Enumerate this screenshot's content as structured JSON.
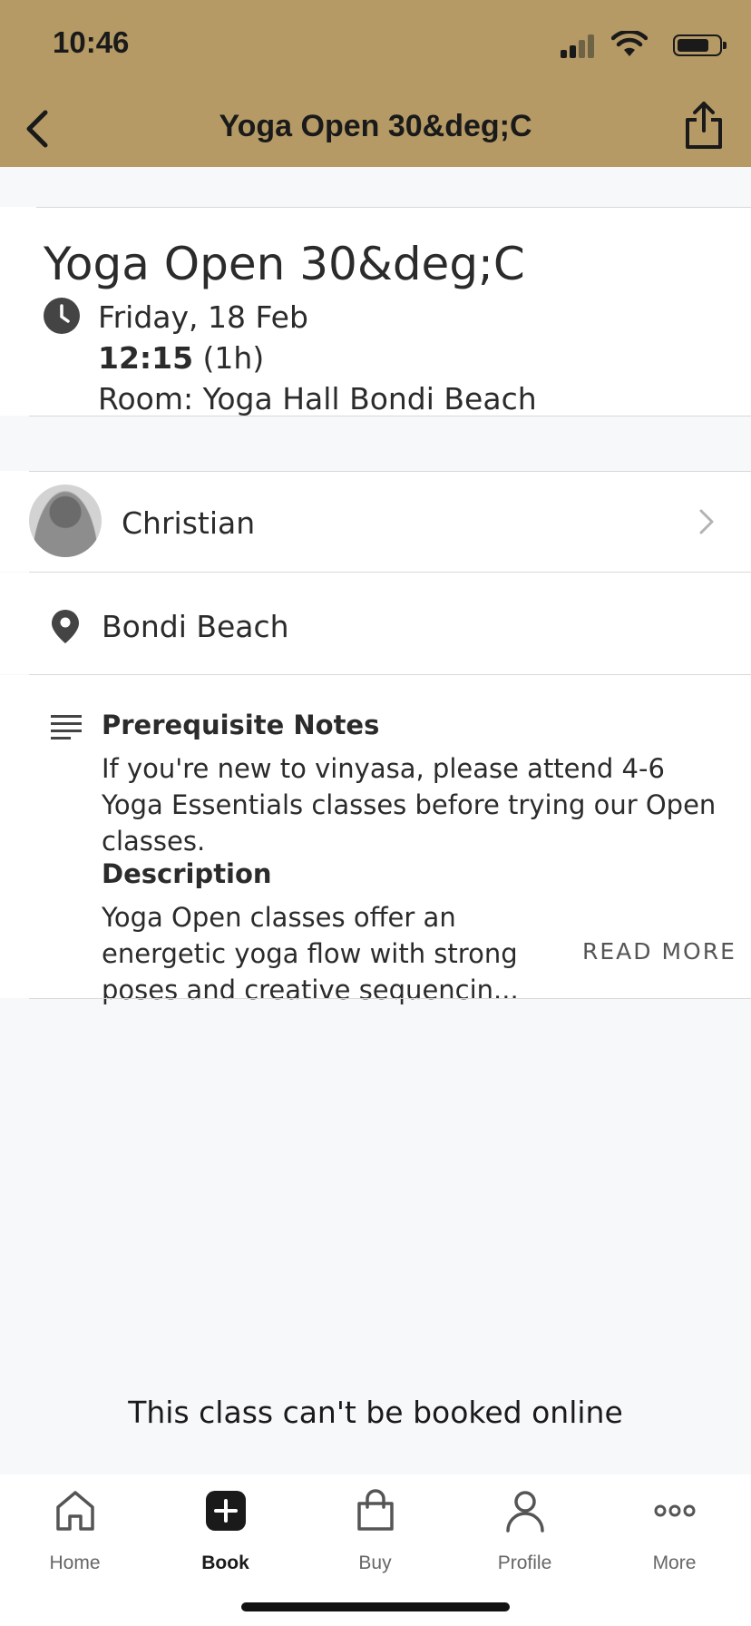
{
  "status_bar": {
    "time": "10:46"
  },
  "header": {
    "title": "Yoga Open 30&deg;C"
  },
  "class_info": {
    "title": "Yoga Open 30&deg;C",
    "date": "Friday, 18 Feb",
    "time": "12:15",
    "duration": "(1h)",
    "room": "Room: Yoga Hall Bondi Beach"
  },
  "instructor": {
    "name": "Christian"
  },
  "location": {
    "name": "Bondi Beach"
  },
  "prerequisites": {
    "title": "Prerequisite Notes",
    "text": "If you're new to vinyasa, please attend 4-6 Yoga Essentials classes before trying our Open classes."
  },
  "description": {
    "title": "Description",
    "text": "Yoga Open classes offer an energetic yoga flow with strong poses and creative sequencin...",
    "read_more": "READ MORE"
  },
  "booking_status": "This class can't be booked online",
  "tabs": [
    {
      "label": "Home",
      "icon": "home-icon"
    },
    {
      "label": "Book",
      "icon": "plus-icon"
    },
    {
      "label": "Buy",
      "icon": "bag-icon"
    },
    {
      "label": "Profile",
      "icon": "person-icon"
    },
    {
      "label": "More",
      "icon": "dots-icon"
    }
  ],
  "colors": {
    "header": "#b59a66",
    "background": "#f7f8fa"
  }
}
